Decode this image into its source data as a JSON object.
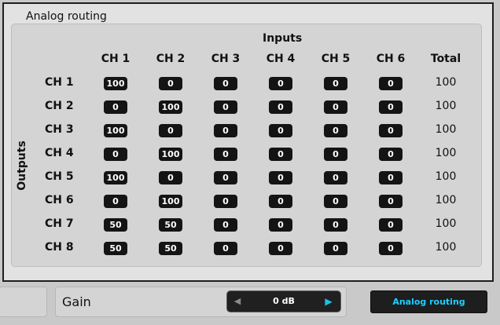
{
  "panel": {
    "title": "Analog routing"
  },
  "matrix": {
    "inputs_label": "Inputs",
    "outputs_label": "Outputs",
    "columns": [
      "CH 1",
      "CH 2",
      "CH 3",
      "CH 4",
      "CH 5",
      "CH 6"
    ],
    "total_label": "Total",
    "rows": [
      {
        "label": "CH 1",
        "values": [
          "100",
          "0",
          "0",
          "0",
          "0",
          "0"
        ],
        "total": "100"
      },
      {
        "label": "CH 2",
        "values": [
          "0",
          "100",
          "0",
          "0",
          "0",
          "0"
        ],
        "total": "100"
      },
      {
        "label": "CH 3",
        "values": [
          "100",
          "0",
          "0",
          "0",
          "0",
          "0"
        ],
        "total": "100"
      },
      {
        "label": "CH 4",
        "values": [
          "0",
          "100",
          "0",
          "0",
          "0",
          "0"
        ],
        "total": "100"
      },
      {
        "label": "CH 5",
        "values": [
          "100",
          "0",
          "0",
          "0",
          "0",
          "0"
        ],
        "total": "100"
      },
      {
        "label": "CH 6",
        "values": [
          "0",
          "100",
          "0",
          "0",
          "0",
          "0"
        ],
        "total": "100"
      },
      {
        "label": "CH 7",
        "values": [
          "50",
          "50",
          "0",
          "0",
          "0",
          "0"
        ],
        "total": "100"
      },
      {
        "label": "CH 8",
        "values": [
          "50",
          "50",
          "0",
          "0",
          "0",
          "0"
        ],
        "total": "100"
      }
    ]
  },
  "gain": {
    "label": "Gain",
    "value": "0 dB",
    "left_arrow": "◀",
    "right_arrow": "▶"
  },
  "route_button": {
    "label": "Analog routing"
  },
  "colors": {
    "accent": "#1ad0ff",
    "cell_bg": "#141414"
  }
}
